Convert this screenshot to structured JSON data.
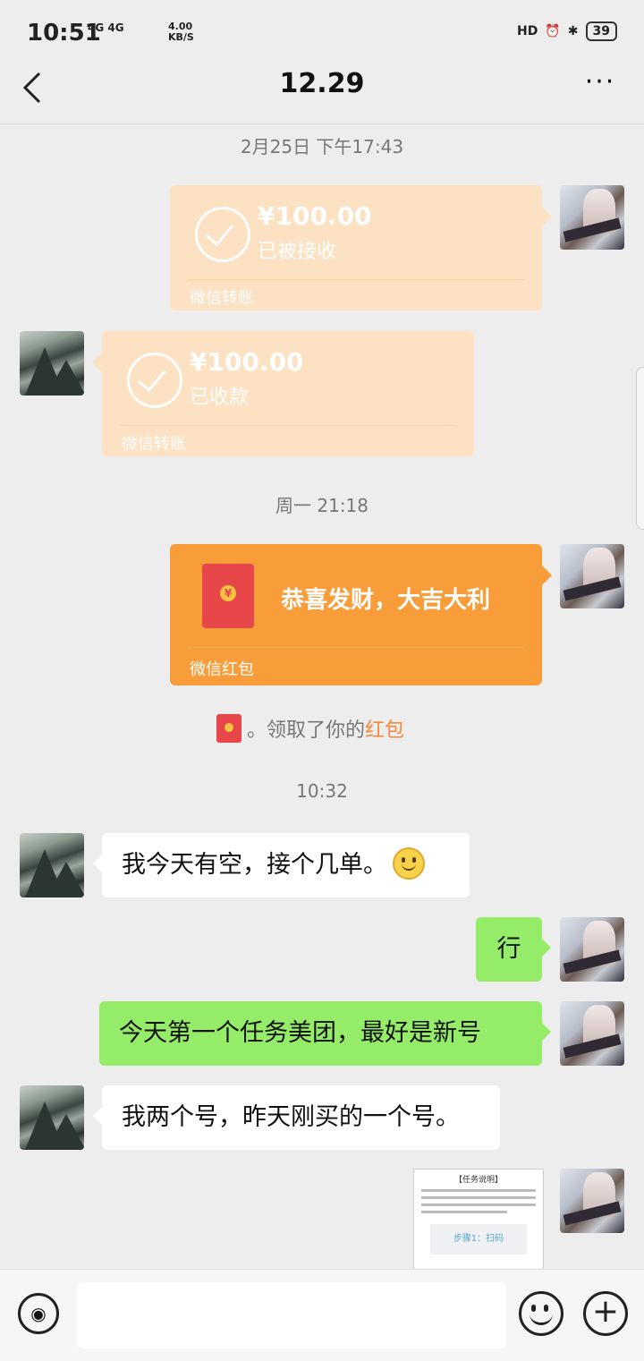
{
  "status_bar": {
    "time": "10:51",
    "network": "4G 4G",
    "speed": "4.00 KB/S",
    "battery": "39"
  },
  "header": {
    "title": "12.29",
    "back_icon": "chevron-left-icon",
    "more_icon": "more-icon",
    "more_label": "···"
  },
  "messages": {
    "ts1": "2月25日 下午17:43",
    "transfer_out": {
      "amount": "¥100.00",
      "status": "已被接收",
      "footer": "微信转账"
    },
    "transfer_in": {
      "amount": "¥100.00",
      "status": "已收款",
      "footer": "微信转账"
    },
    "ts2": "周一 21:18",
    "red_packet": {
      "text": "恭喜发财，大吉大利",
      "footer": "微信红包",
      "coin": "¥"
    },
    "system_notice": {
      "text": "。领取了你的",
      "link": "红包"
    },
    "ts3": "10:32",
    "bubble1": "我今天有空，接个几单。",
    "bubble2": "行",
    "bubble3": "今天第一个任务美团，最好是新号",
    "bubble4": "我两个号，昨天刚买的一个号。",
    "image_doc": {
      "title": "【任务说明】",
      "step": "步骤1：扫码"
    }
  },
  "input_bar": {
    "voice_icon": "voice-icon",
    "emoji_icon": "emoji-icon",
    "plus_icon": "plus-icon",
    "plus_label": "+",
    "voice_label": "◉"
  },
  "colors": {
    "background": "#ededed",
    "transfer_card": "#fde1c3",
    "red_packet_card": "#f99d3a",
    "outgoing_bubble": "#95ec69",
    "incoming_bubble": "#ffffff",
    "link": "#f5883a"
  }
}
